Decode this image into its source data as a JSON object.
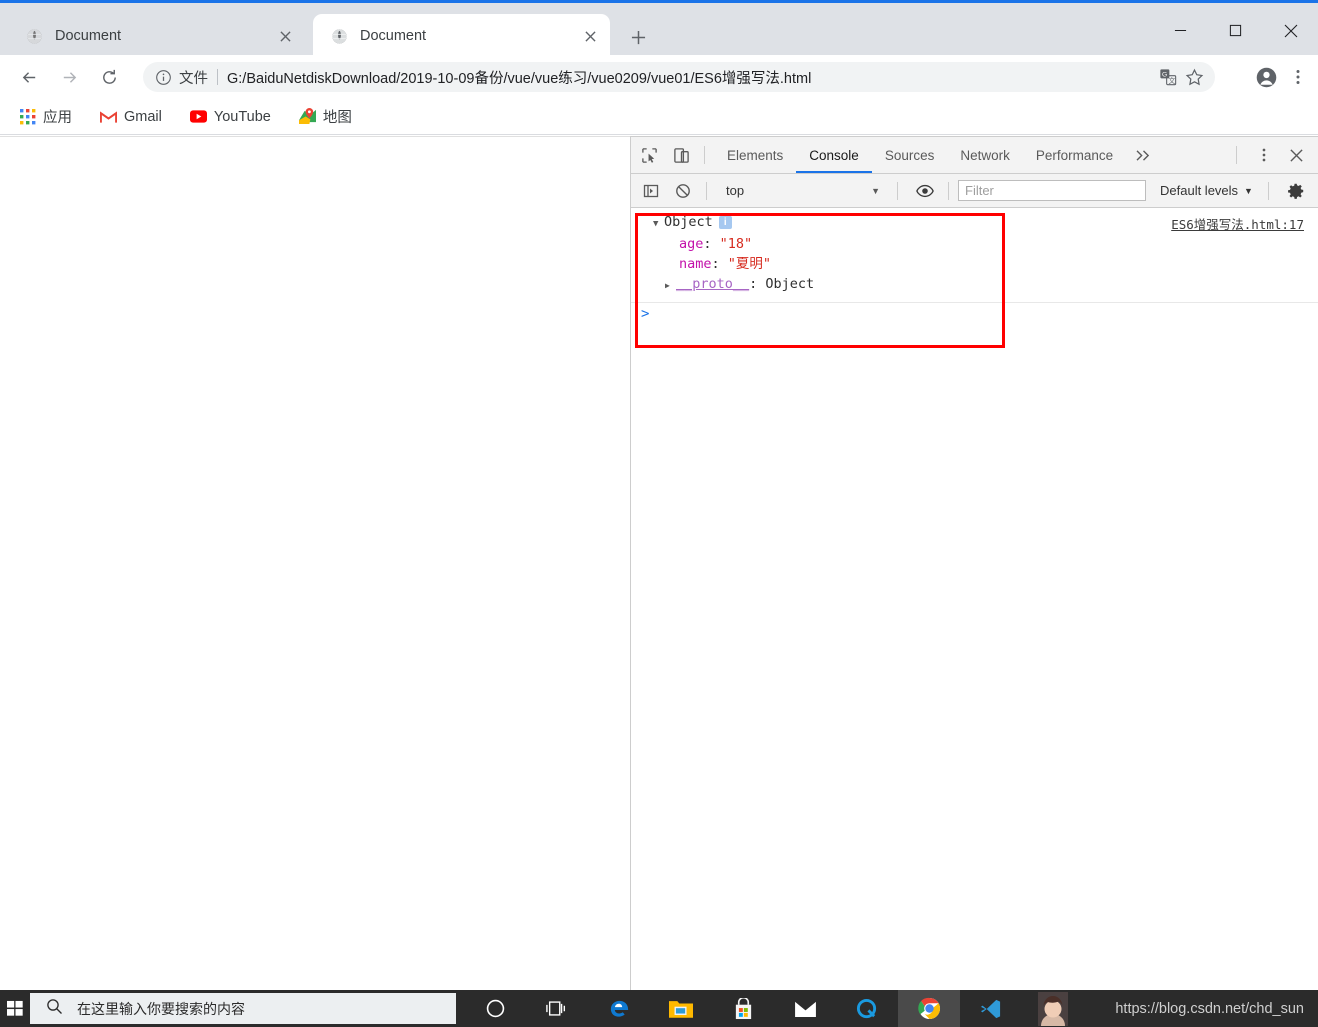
{
  "browser": {
    "tabs": [
      {
        "title": "Document",
        "favicon": "globe-icon",
        "active": false
      },
      {
        "title": "Document",
        "favicon": "globe-icon",
        "active": true
      }
    ],
    "new_tab_label": "+",
    "window_controls": {
      "minimize": "minimize-icon",
      "maximize": "maximize-icon",
      "close": "close-icon"
    },
    "omnibox": {
      "info_icon": "info-circle-icon",
      "scheme_label": "文件",
      "url": "G:/BaiduNetdiskDownload/2019-10-09备份/vue/vue练习/vue0209/vue01/ES6增强写法.html",
      "translate_icon": "translate-icon",
      "bookmark_icon": "star-icon"
    },
    "nav": {
      "back": "arrow-left-icon",
      "forward": "arrow-right-icon",
      "reload": "reload-icon"
    },
    "profile_icon": "account-circle-icon",
    "menu_icon": "more-vertical-icon",
    "bookmarks": [
      {
        "label": "应用",
        "icon": "apps-grid-icon"
      },
      {
        "label": "Gmail",
        "icon": "gmail-icon"
      },
      {
        "label": "YouTube",
        "icon": "youtube-icon"
      },
      {
        "label": "地图",
        "icon": "maps-pin-icon"
      }
    ]
  },
  "devtools": {
    "inspect_icon": "inspect-element-icon",
    "device_icon": "device-toolbar-icon",
    "tabs": [
      {
        "label": "Elements",
        "active": false
      },
      {
        "label": "Console",
        "active": true
      },
      {
        "label": "Sources",
        "active": false
      },
      {
        "label": "Network",
        "active": false
      },
      {
        "label": "Performance",
        "active": false
      }
    ],
    "more_tabs_icon": "chevron-double-right-icon",
    "settings_menu_icon": "more-vertical-icon",
    "close_icon": "close-icon",
    "console_toolbar": {
      "sidebar_icon": "console-sidebar-icon",
      "clear_icon": "clear-console-icon",
      "context": "top",
      "context_caret": "▼",
      "eye_icon": "live-expression-eye-icon",
      "filter_placeholder": "Filter",
      "filter_value": "",
      "levels_label": "Default levels",
      "levels_caret": "▼",
      "gear_icon": "settings-gear-icon"
    },
    "console_output": {
      "highlight_color": "#ff0000",
      "message": {
        "expand_triangle": "▼",
        "object_label": "Object",
        "info_badge": "i",
        "source_link": "ES6增强写法.html:17",
        "properties": [
          {
            "key": "age",
            "value": "\"18\""
          },
          {
            "key": "name",
            "value": "\"夏明\""
          }
        ],
        "proto": {
          "triangle": "▶",
          "key": "__proto__",
          "value": "Object"
        }
      },
      "prompt_caret": ">"
    }
  },
  "taskbar": {
    "start_icon": "windows-start-icon",
    "search_icon": "search-icon",
    "search_placeholder": "在这里输入你要搜索的内容",
    "icons": [
      {
        "name": "cortana-icon",
        "active": false
      },
      {
        "name": "task-view-icon",
        "active": false
      },
      {
        "name": "edge-icon",
        "active": false
      },
      {
        "name": "file-explorer-icon",
        "active": false
      },
      {
        "name": "microsoft-store-icon",
        "active": false
      },
      {
        "name": "mail-icon",
        "active": false
      },
      {
        "name": "quark-browser-icon",
        "active": false
      },
      {
        "name": "chrome-icon",
        "active": true
      },
      {
        "name": "vscode-icon",
        "active": false
      },
      {
        "name": "avatar-icon",
        "active": false
      }
    ],
    "watermark": "https://blog.csdn.net/chd_sun"
  }
}
